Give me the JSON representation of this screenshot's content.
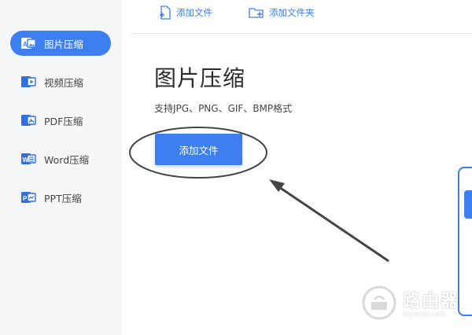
{
  "sidebar": {
    "items": [
      {
        "label": "图片压缩",
        "icon": "image-compress-icon",
        "active": true
      },
      {
        "label": "视频压缩",
        "icon": "video-compress-icon",
        "active": false
      },
      {
        "label": "PDF压缩",
        "icon": "pdf-compress-icon",
        "active": false
      },
      {
        "label": "Word压缩",
        "icon": "word-compress-icon",
        "active": false
      },
      {
        "label": "PPT压缩",
        "icon": "ppt-compress-icon",
        "active": false
      }
    ]
  },
  "toolbar": {
    "add_file_label": "添加文件",
    "add_folder_label": "添加文件夹"
  },
  "main": {
    "title": "图片压缩",
    "subtitle": "支持JPG、PNG、GIF、BMP格式",
    "add_button_label": "添加文件"
  },
  "watermark": {
    "text": "路由器",
    "subtext": "luyouqi.com"
  },
  "colors": {
    "accent": "#3d7ff0",
    "sidebar_bg": "#f5f6f8",
    "annotation": "#444444"
  }
}
